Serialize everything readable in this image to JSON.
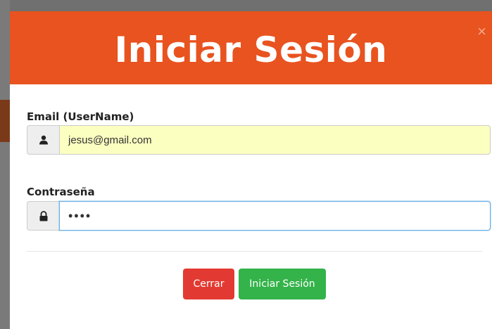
{
  "modal": {
    "title": "Iniciar Sesión",
    "close_glyph": "×"
  },
  "email": {
    "label": "Email (UserName)",
    "value": "jesus@gmail.com",
    "icon": "user-icon"
  },
  "password": {
    "label": "Contraseña",
    "value": "••••",
    "icon": "lock-icon"
  },
  "buttons": {
    "close_label": "Cerrar",
    "login_label": "Iniciar Sesión"
  },
  "colors": {
    "header": "#e8531f",
    "close_button": "#e23a32",
    "login_button": "#34b34a",
    "email_autofill": "#fbffc0",
    "focus_border": "#66afe9"
  }
}
